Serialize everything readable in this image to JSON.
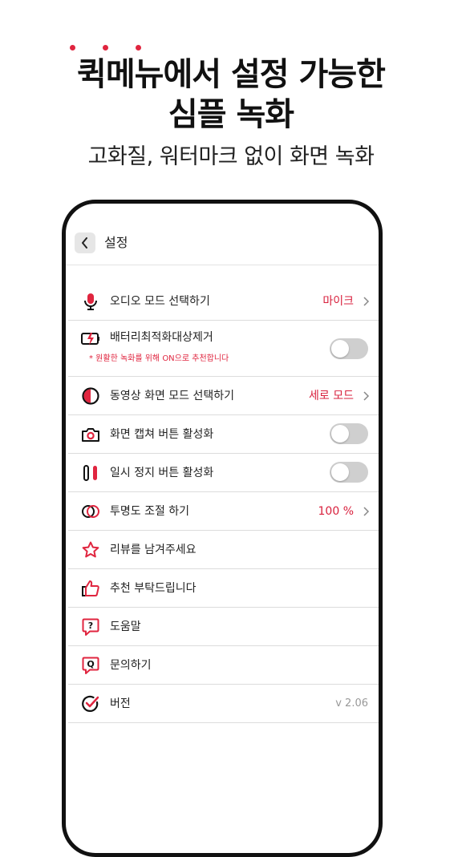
{
  "promo": {
    "headline_line1": "퀵메뉴에서 설정 가능한",
    "headline_line2": "심플 녹화",
    "subheadline": "고화질, 워터마크 없이 화면 녹화"
  },
  "colors": {
    "accent": "#e0253f",
    "value_text": "#d81f3c",
    "toggle_off": "#cfcfcf"
  },
  "topbar": {
    "back_icon": "chevron-left-icon",
    "title": "설정"
  },
  "settings": {
    "audio_mode": {
      "icon": "microphone-icon",
      "label": "오디오 모드 선택하기",
      "value": "마이크"
    },
    "battery_opt": {
      "icon": "battery-bolt-icon",
      "label": "배터리최적화대상제거",
      "note": "* 원활한 녹화를 위해 ON으로 추천합니다",
      "enabled": false
    },
    "video_mode": {
      "icon": "half-circle-icon",
      "label": "동영상 화면 모드 선택하기",
      "value": "세로 모드"
    },
    "capture_button": {
      "icon": "camera-icon",
      "label": "화면 캡쳐 버튼 활성화",
      "enabled": false
    },
    "pause_button": {
      "icon": "pause-icon",
      "label": "일시 정지 버튼 활성화",
      "enabled": false
    },
    "opacity": {
      "icon": "overlap-circles-icon",
      "label": "투명도 조절 하기",
      "value": "100 %"
    },
    "review": {
      "icon": "star-icon",
      "label": "리뷰를 남겨주세요"
    },
    "recommend": {
      "icon": "thumbs-up-icon",
      "label": "추천 부탁드립니다"
    },
    "help": {
      "icon": "question-bubble-icon",
      "label": "도움말"
    },
    "contact": {
      "icon": "q-bubble-icon",
      "label": "문의하기"
    },
    "version": {
      "icon": "check-circle-icon",
      "label": "버전",
      "value": "v 2.06"
    }
  }
}
